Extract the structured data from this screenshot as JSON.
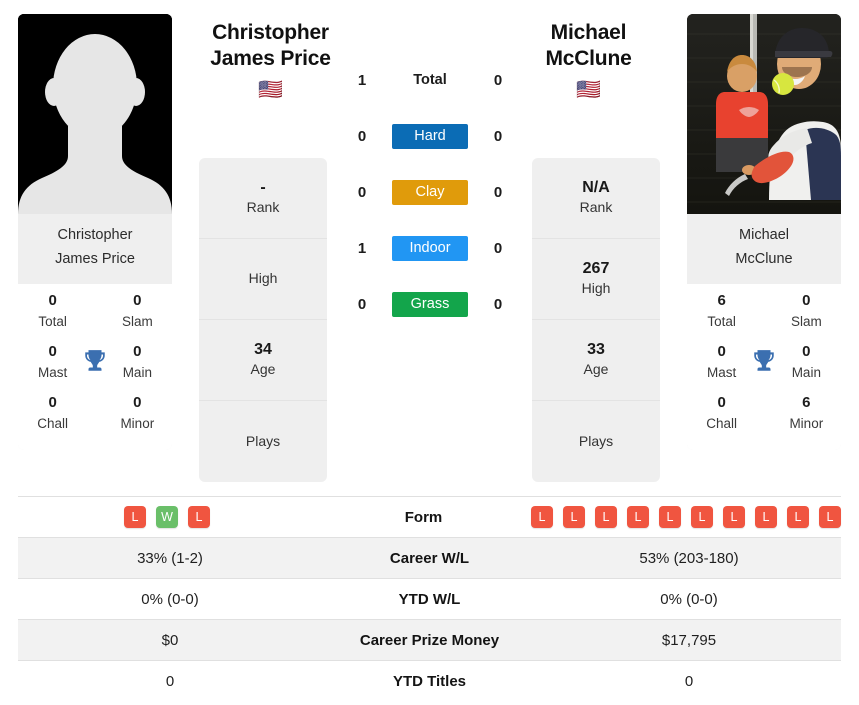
{
  "players": {
    "left": {
      "name": "Christopher James Price",
      "name_line1": "Christopher",
      "name_line2": "James Price",
      "flag": "🇺🇸",
      "photo_caption_line1": "Christopher",
      "photo_caption_line2": "James Price",
      "avatar_type": "silhouette-placeholder",
      "stat_cards": [
        {
          "value": "-",
          "label": "Rank"
        },
        {
          "value": "",
          "label": "High"
        },
        {
          "value": "34",
          "label": "Age"
        },
        {
          "value": "",
          "label": "Plays"
        }
      ],
      "titles": [
        {
          "value": "0",
          "label": "Total"
        },
        {
          "value": "0",
          "label": "Slam"
        },
        {
          "value": "0",
          "label": "Mast"
        },
        {
          "value": "0",
          "label": "Main"
        },
        {
          "value": "0",
          "label": "Chall"
        },
        {
          "value": "0",
          "label": "Minor"
        }
      ],
      "form": [
        "L",
        "W",
        "L"
      ],
      "career_wl": "33% (1-2)",
      "ytd_wl": "0% (0-0)",
      "career_prize_money": "$0",
      "ytd_titles": "0"
    },
    "right": {
      "name": "Michael McClune",
      "name_line1": "Michael",
      "name_line2": "McClune",
      "flag": "🇺🇸",
      "photo_caption_line1": "Michael",
      "photo_caption_line2": "McClune",
      "avatar_type": "photo",
      "stat_cards": [
        {
          "value": "N/A",
          "label": "Rank"
        },
        {
          "value": "267",
          "label": "High"
        },
        {
          "value": "33",
          "label": "Age"
        },
        {
          "value": "",
          "label": "Plays"
        }
      ],
      "titles": [
        {
          "value": "6",
          "label": "Total"
        },
        {
          "value": "0",
          "label": "Slam"
        },
        {
          "value": "0",
          "label": "Mast"
        },
        {
          "value": "0",
          "label": "Main"
        },
        {
          "value": "0",
          "label": "Chall"
        },
        {
          "value": "6",
          "label": "Minor"
        }
      ],
      "form": [
        "L",
        "L",
        "L",
        "L",
        "L",
        "L",
        "L",
        "L",
        "L",
        "L"
      ],
      "career_wl": "53% (203-180)",
      "ytd_wl": "0% (0-0)",
      "career_prize_money": "$17,795",
      "ytd_titles": "0"
    }
  },
  "head_to_head": {
    "rows": [
      {
        "label": "Total",
        "left": "1",
        "right": "0",
        "color": "",
        "style": "plain"
      },
      {
        "label": "Hard",
        "left": "0",
        "right": "0",
        "color": "#0b6cb5",
        "style": "pill"
      },
      {
        "label": "Clay",
        "left": "0",
        "right": "0",
        "color": "#e09b0b",
        "style": "pill"
      },
      {
        "label": "Indoor",
        "left": "1",
        "right": "0",
        "color": "#2196f3",
        "style": "pill"
      },
      {
        "label": "Grass",
        "left": "0",
        "right": "0",
        "color": "#13a54b",
        "style": "pill"
      }
    ]
  },
  "stats_table": {
    "rows": [
      {
        "label": "Form",
        "key": "form",
        "type": "badges"
      },
      {
        "label": "Career W/L",
        "key": "career_wl",
        "type": "text"
      },
      {
        "label": "YTD W/L",
        "key": "ytd_wl",
        "type": "text"
      },
      {
        "label": "Career Prize Money",
        "key": "career_prize_money",
        "type": "text"
      },
      {
        "label": "YTD Titles",
        "key": "ytd_titles",
        "type": "text"
      }
    ]
  },
  "colors": {
    "win_badge": "#6abf69",
    "loss_badge": "#f05540",
    "trophy": "#3b6fb0",
    "card_bg": "#efefef",
    "row_alt_bg": "#f2f2f2"
  }
}
